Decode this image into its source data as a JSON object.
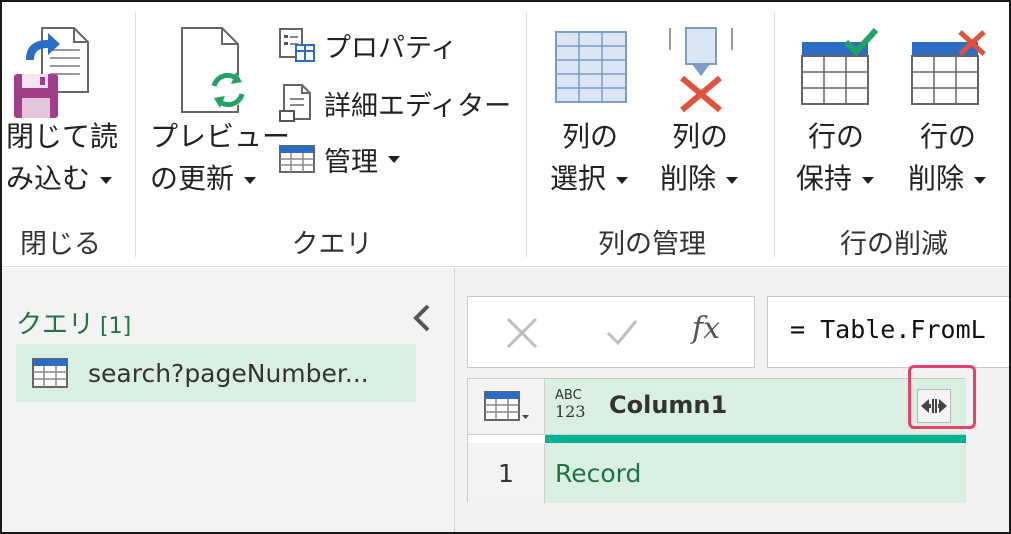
{
  "ribbon": {
    "close_group": {
      "label": "閉じる",
      "close_load_btn": {
        "line1": "閉じて読",
        "line2": "み込む"
      }
    },
    "query_group": {
      "label": "クエリ",
      "preview_refresh_btn": {
        "line1": "プレビュー",
        "line2": "の更新"
      },
      "properties_btn": "プロパティ",
      "advanced_editor_btn": "詳細エディター",
      "manage_btn": "管理"
    },
    "manage_columns_group": {
      "label": "列の管理",
      "choose_columns_btn": {
        "line1": "列の",
        "line2": "選択"
      },
      "remove_columns_btn": {
        "line1": "列の",
        "line2": "削除"
      }
    },
    "reduce_rows_group": {
      "label": "行の削減",
      "keep_rows_btn": {
        "line1": "行の",
        "line2": "保持"
      },
      "remove_rows_btn": {
        "line1": "行の",
        "line2": "削除"
      }
    }
  },
  "queries_pane": {
    "title": "クエリ",
    "count": "[1]",
    "items": [
      {
        "label": "search?pageNumber..."
      }
    ]
  },
  "formula_bar": {
    "fx": "fx",
    "formula": "= Table.FromL"
  },
  "grid": {
    "column": {
      "type_top": "ABC",
      "type_bottom": "123",
      "name": "Column1"
    },
    "rows": [
      {
        "num": "1",
        "value": "Record"
      }
    ]
  },
  "colors": {
    "accent_green": "#217346",
    "selection_green": "#d9efe1",
    "quality_teal": "#00b294",
    "highlight_pink": "#e83f6b"
  }
}
